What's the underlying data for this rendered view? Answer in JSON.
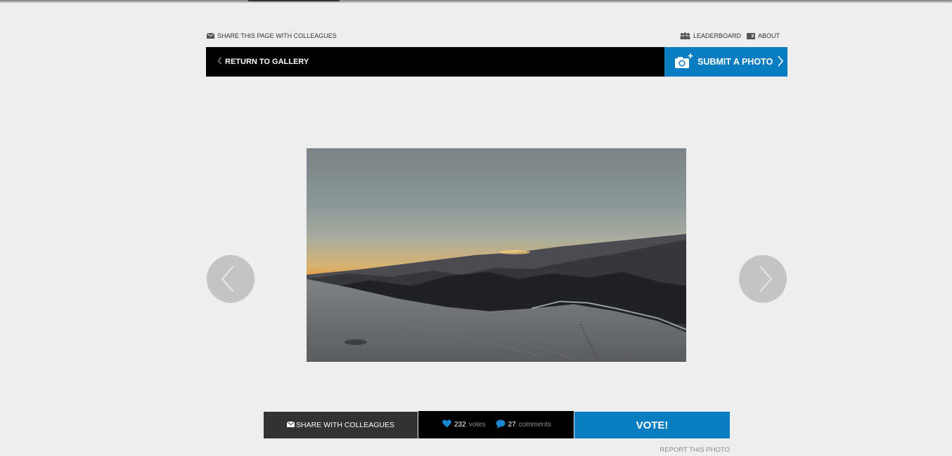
{
  "header": {
    "share_page": "SHARE THIS PAGE WITH COLLEAGUES",
    "leaderboard": "LEADERBOARD",
    "about": "ABOUT"
  },
  "nav": {
    "return": "RETURN TO GALLERY",
    "submit": "SUBMIT A PHOTO"
  },
  "photo": {
    "icon": "mountain-sunrise-photo"
  },
  "actions": {
    "share": "SHARE WITH COLLEAGUES",
    "votes_count": "232",
    "votes_label": "votes",
    "comments_count": "27",
    "comments_label": "comments",
    "vote": "VOTE!",
    "report": "REPORT THIS PHOTO"
  },
  "colors": {
    "accent": "#0a7cc2",
    "navbar": "#000000",
    "background": "#eeeeee"
  }
}
